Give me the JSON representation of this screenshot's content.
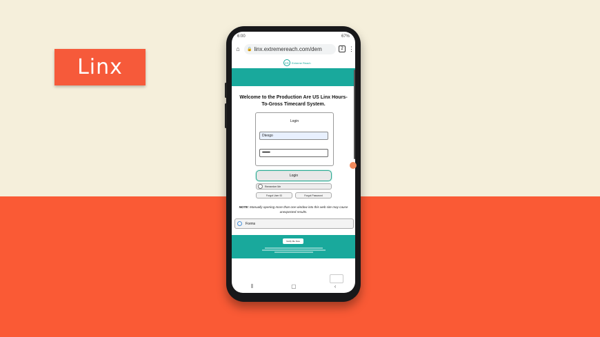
{
  "slide": {
    "badge": "Linx",
    "colors": {
      "top_background": "#f5efdb",
      "bottom_background": "#fa5a35",
      "badge": "#f65a3a"
    }
  },
  "status_bar": {
    "time": "6:00",
    "battery": "67%"
  },
  "browser": {
    "url": "linx.extremereach.com/dem",
    "tab_count": "2",
    "home_icon": "home-icon",
    "menu_icon": "more-vert-icon"
  },
  "site": {
    "logo_text": "Extreme Reach",
    "teal_color": "#19a99c",
    "welcome": "Welcome to the Production Are US Linx Hours-To-Gross Timecard System.",
    "login_box": {
      "title": "Login",
      "username_value": "Dtexgo",
      "password_value": "••••••••••"
    },
    "login_button": "Login",
    "remember_me": "Remember Me",
    "forgot_user_id": "Forgot User ID",
    "forgot_password": "Forgot Password",
    "note_label": "NOTE:",
    "note_text": "Manually opening more than one window into this web site may cause unexpected results.",
    "forms_label": "Forms",
    "footer": {
      "notify_button": "Notify Me Now"
    }
  }
}
